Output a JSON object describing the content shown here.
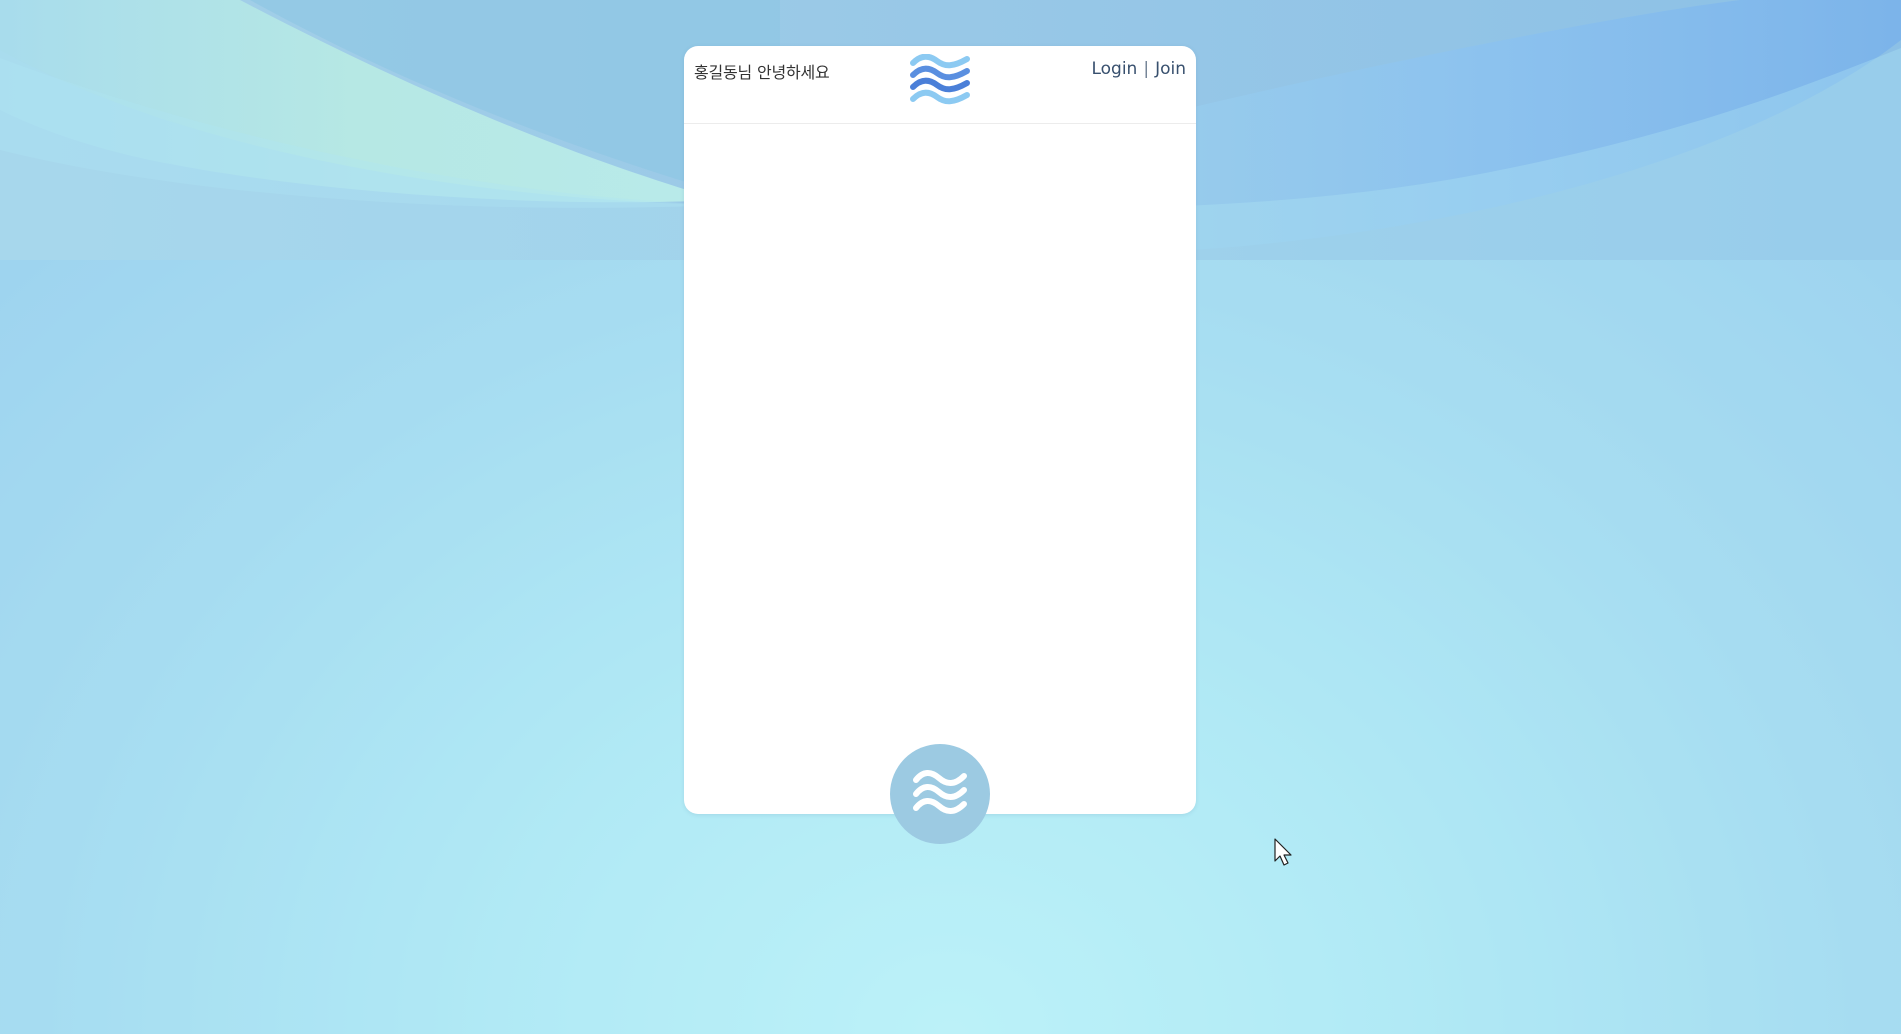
{
  "header": {
    "greeting": "홍길동님 안녕하세요",
    "login_label": "Login",
    "separator": "|",
    "join_label": "Join",
    "logo_icon": "wave-logo-icon"
  },
  "fab": {
    "icon": "wave-icon"
  },
  "colors": {
    "background_center": "#c3f8fb",
    "background_edge": "#96cbed",
    "fab": "#9ccae2",
    "logo_wave_light": "#8ccaf2",
    "logo_wave_dark": "#4a7fd8",
    "link_text": "#38506e"
  }
}
